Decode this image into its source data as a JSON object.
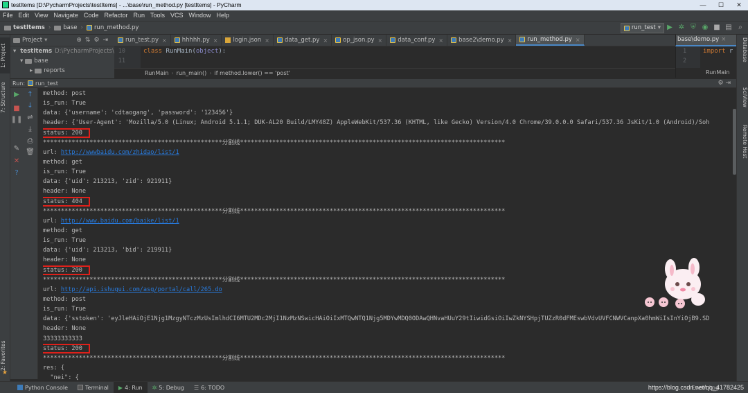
{
  "window": {
    "title": "testItems [D:\\PycharmProjects\\testItems] - ...\\base\\run_method.py [testItems] - PyCharm",
    "controls": [
      "—",
      "☐",
      "✕"
    ]
  },
  "menu": [
    "File",
    "Edit",
    "View",
    "Navigate",
    "Code",
    "Refactor",
    "Run",
    "Tools",
    "VCS",
    "Window",
    "Help"
  ],
  "navbar": {
    "crumbs": [
      "testItems",
      "base",
      "run_method.py"
    ],
    "run_config": "run_test"
  },
  "left_stripe": {
    "project": "1: Project",
    "structure": "7: Structure",
    "favorites": "2: Favorites"
  },
  "project_panel": {
    "title": "Project",
    "tree": [
      {
        "label": "testItems",
        "path": "D:\\PycharmProjects\\testItems"
      },
      {
        "label": "base"
      },
      {
        "label": "reports"
      }
    ]
  },
  "editor": {
    "tabs": [
      "run_test.py",
      "hhhhh.py",
      "login.json",
      "data_get.py",
      "op_json.py",
      "data_conf.py",
      "base2\\demo.py",
      "run_method.py"
    ],
    "active_tab": "run_method.py",
    "lines": [
      {
        "num": "10",
        "kw": "class ",
        "name": "RunMain",
        "rest": "(",
        "base": "object",
        "end": "):"
      },
      {
        "num": "11",
        "text": ""
      }
    ],
    "breadcrumb": [
      "RunMain",
      "run_main()",
      "if method.lower() == 'post'"
    ]
  },
  "right_editor": {
    "tab": "base\\demo.py",
    "lines": [
      {
        "num": "1",
        "kw": "import",
        "rest": " r"
      },
      {
        "num": "2",
        "text": ""
      }
    ],
    "breadcrumb": "RunMain"
  },
  "right_stripe": {
    "database": "Database",
    "sciview": "SciView",
    "remote": "Remote Host"
  },
  "run_panel": {
    "label": "Run:",
    "config": "run_test"
  },
  "console": {
    "separator": "**************************************************分割线**************************************************************************",
    "lines": [
      {
        "t": "method: post"
      },
      {
        "t": "is_run: True"
      },
      {
        "t": "data: {'username': 'cdtaogang', 'password': '123456'}"
      },
      {
        "t": "header: {'User-Agent': 'Mozilla/5.0 (Linux; Android 5.1.1; DUK-AL20 Build/LMY48Z) AppleWebKit/537.36 (KHTML, like Gecko) Version/4.0 Chrome/39.0.0.0 Safari/537.36 JsKit/1.0 (Android)/Soh"
      },
      {
        "t": "status: 200",
        "box": true
      },
      {
        "t": "sep"
      },
      {
        "pre": "url: ",
        "link": "http://wwwbaidu.com/zhidao/list/1"
      },
      {
        "t": "method: get"
      },
      {
        "t": "is_run: True"
      },
      {
        "t": "data: {'uid': 213213, 'zid': 921911}"
      },
      {
        "t": "header: None"
      },
      {
        "t": "status: 404",
        "box": true
      },
      {
        "t": "sep"
      },
      {
        "pre": "url: ",
        "link": "http://www.baidu.com/baike/list/1"
      },
      {
        "t": "method: get"
      },
      {
        "t": "is_run: True"
      },
      {
        "t": "data: {'uid': 213213, 'bid': 219911}"
      },
      {
        "t": "header: None"
      },
      {
        "t": "status: 200",
        "box": true
      },
      {
        "t": "sep"
      },
      {
        "pre": "url: ",
        "link": "http://api.ishugui.com/asg/portal/call/265.do"
      },
      {
        "t": "method: post"
      },
      {
        "t": "is_run: True"
      },
      {
        "t": "data: {'sstoken': 'eyJleHAiOjE1Njg1MzgyNTczMzUsImlhdCI6MTU2MDc2MjI1NzMzNSwicHAiOiIxMTQwNTQ1Njg5MDYwMDQ0ODAwQHNvaHUuY29tIiwidGsiOiIwZkNYSHpjTUZzR0dFMEswbVdvUVFCNWVCanpXa0hmWiIsInYiOjB9.SD"
      },
      {
        "t": "header: None"
      },
      {
        "t": "33333333333"
      },
      {
        "t": "status: 200",
        "box": true
      },
      {
        "t": "sep"
      },
      {
        "t": "res: {"
      },
      {
        "t": "  \"nei\": {"
      }
    ]
  },
  "bottom_tabs": [
    {
      "label": "Python Console"
    },
    {
      "label": "Terminal"
    },
    {
      "label": "4: Run",
      "active": true
    },
    {
      "label": "5: Debug"
    },
    {
      "label": "6: TODO"
    }
  ],
  "status_right": "Event Log",
  "watermark": "https://blog.csdn.net/qq_41782425",
  "colors": {
    "accent": "#4a88c7",
    "highlight_box": "#e0201a",
    "link": "#287bde",
    "keyword": "#cc7832"
  }
}
